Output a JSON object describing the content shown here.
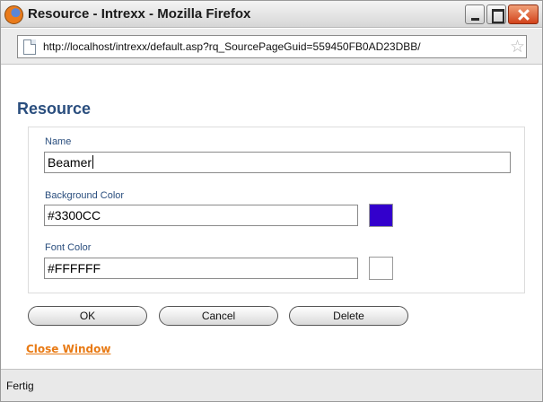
{
  "window": {
    "title": "Resource - Intrexx - Mozilla Firefox",
    "controls": [
      "minimize",
      "maximize",
      "close"
    ]
  },
  "address_bar": {
    "url": "http://localhost/intrexx/default.asp?rq_SourcePageGuid=559450FB0AD23DBB/",
    "page_icon": "page-icon",
    "bookmark_icon": "star-icon"
  },
  "form": {
    "heading": "Resource",
    "fields": [
      {
        "label": "Name",
        "value": "Beamer"
      },
      {
        "label": "Background Color",
        "value": "#3300CC",
        "swatch_color": "#3300CC"
      },
      {
        "label": "Font Color",
        "value": "#FFFFFF",
        "swatch_color": "#FFFFFF"
      }
    ],
    "buttons": {
      "ok": "OK",
      "cancel": "Cancel",
      "delete": "Delete"
    },
    "close_link": "Close Window"
  },
  "colors": {
    "heading": "#2a4e7e",
    "link": "#e87a14"
  },
  "status_bar": {
    "text": "Fertig"
  }
}
